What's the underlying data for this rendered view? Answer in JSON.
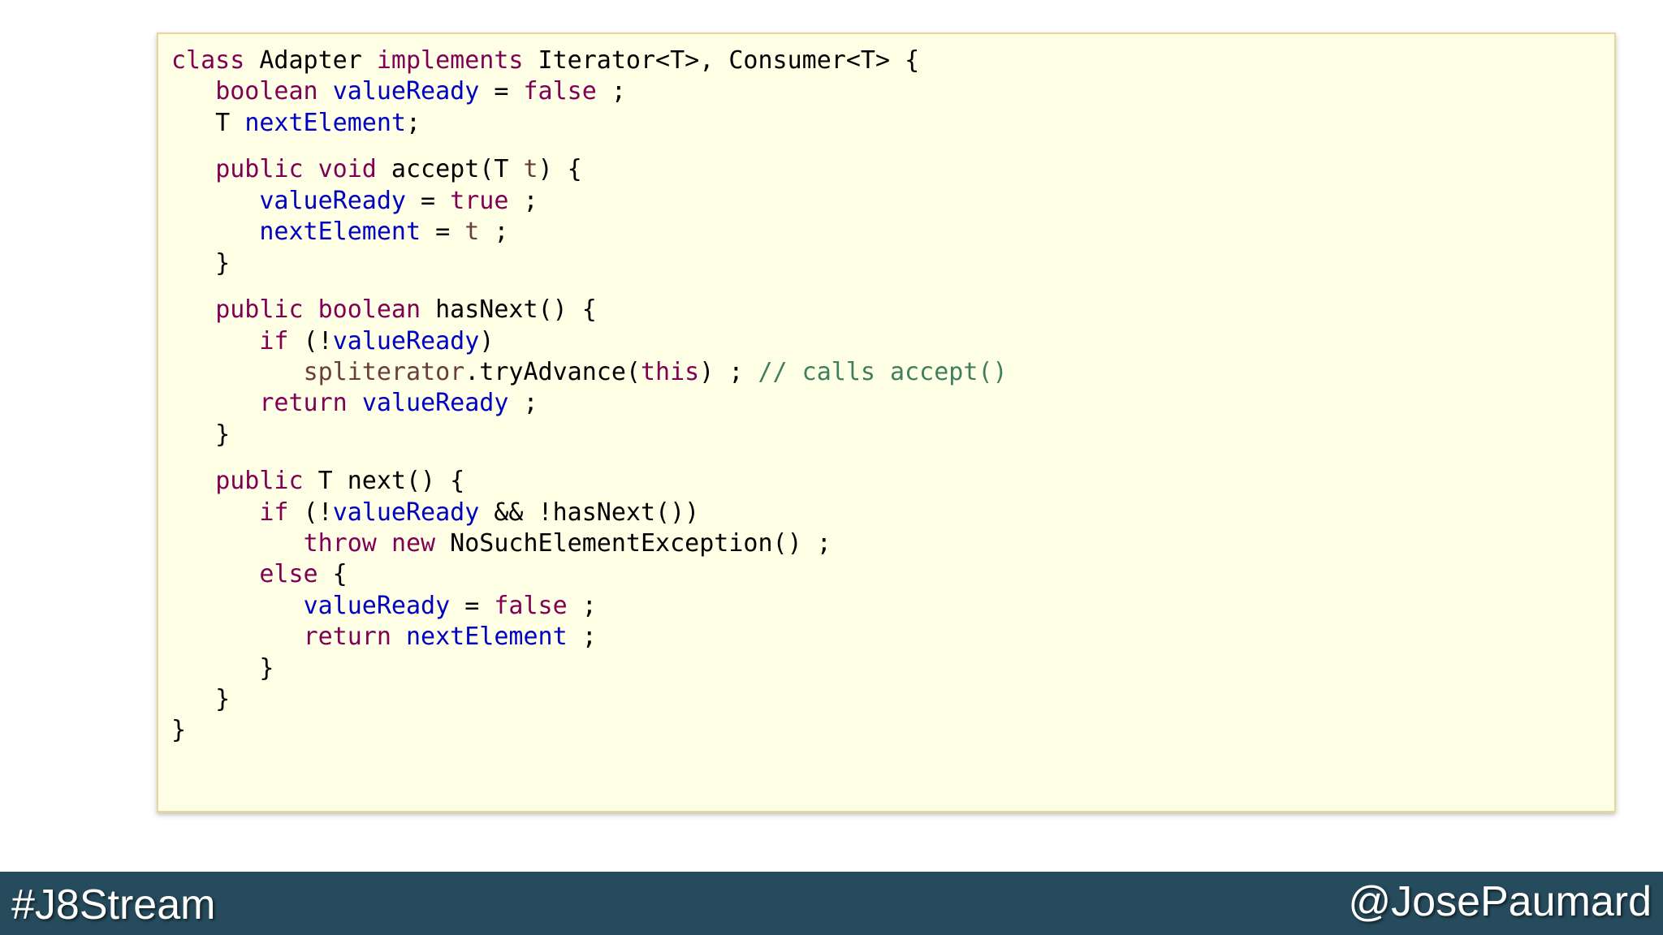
{
  "code": {
    "lines": [
      [
        {
          "t": "class",
          "c": "kw"
        },
        {
          "t": " Adapter "
        },
        {
          "t": "implements",
          "c": "kw"
        },
        {
          "t": " Iterator<T>, Consumer<T> {"
        }
      ],
      [
        {
          "t": "   "
        },
        {
          "t": "boolean",
          "c": "kw"
        },
        {
          "t": " "
        },
        {
          "t": "valueReady",
          "c": "fld"
        },
        {
          "t": " = "
        },
        {
          "t": "false",
          "c": "kw"
        },
        {
          "t": " ;"
        }
      ],
      [
        {
          "t": "   T "
        },
        {
          "t": "nextElement",
          "c": "fld"
        },
        {
          "t": ";"
        }
      ],
      "gap",
      [
        {
          "t": "   "
        },
        {
          "t": "public",
          "c": "kw"
        },
        {
          "t": " "
        },
        {
          "t": "void",
          "c": "kw"
        },
        {
          "t": " accept(T "
        },
        {
          "t": "t",
          "c": "prm"
        },
        {
          "t": ") {"
        }
      ],
      [
        {
          "t": "      "
        },
        {
          "t": "valueReady",
          "c": "fld"
        },
        {
          "t": " = "
        },
        {
          "t": "true",
          "c": "kw"
        },
        {
          "t": " ;"
        }
      ],
      [
        {
          "t": "      "
        },
        {
          "t": "nextElement",
          "c": "fld"
        },
        {
          "t": " = "
        },
        {
          "t": "t",
          "c": "prm"
        },
        {
          "t": " ;"
        }
      ],
      [
        {
          "t": "   }"
        }
      ],
      "gap",
      [
        {
          "t": "   "
        },
        {
          "t": "public",
          "c": "kw"
        },
        {
          "t": " "
        },
        {
          "t": "boolean",
          "c": "kw"
        },
        {
          "t": " hasNext() {"
        }
      ],
      [
        {
          "t": "      "
        },
        {
          "t": "if",
          "c": "kw"
        },
        {
          "t": " (!"
        },
        {
          "t": "valueReady",
          "c": "fld"
        },
        {
          "t": ")"
        }
      ],
      [
        {
          "t": "         "
        },
        {
          "t": "spliterator",
          "c": "prm"
        },
        {
          "t": ".tryAdvance("
        },
        {
          "t": "this",
          "c": "kw"
        },
        {
          "t": ") ; "
        },
        {
          "t": "// calls accept()",
          "c": "cmt"
        }
      ],
      [
        {
          "t": "      "
        },
        {
          "t": "return",
          "c": "kw"
        },
        {
          "t": " "
        },
        {
          "t": "valueReady",
          "c": "fld"
        },
        {
          "t": " ;"
        }
      ],
      [
        {
          "t": "   }"
        }
      ],
      "gap",
      [
        {
          "t": "   "
        },
        {
          "t": "public",
          "c": "kw"
        },
        {
          "t": " T next() {"
        }
      ],
      [
        {
          "t": "      "
        },
        {
          "t": "if",
          "c": "kw"
        },
        {
          "t": " (!"
        },
        {
          "t": "valueReady",
          "c": "fld"
        },
        {
          "t": " && !hasNext())"
        }
      ],
      [
        {
          "t": "         "
        },
        {
          "t": "throw",
          "c": "kw"
        },
        {
          "t": " "
        },
        {
          "t": "new",
          "c": "kw"
        },
        {
          "t": " NoSuchElementException() ;"
        }
      ],
      [
        {
          "t": "      "
        },
        {
          "t": "else",
          "c": "kw"
        },
        {
          "t": " {"
        }
      ],
      [
        {
          "t": "         "
        },
        {
          "t": "valueReady",
          "c": "fld"
        },
        {
          "t": " = "
        },
        {
          "t": "false",
          "c": "kw"
        },
        {
          "t": " ;"
        }
      ],
      [
        {
          "t": "         "
        },
        {
          "t": "return",
          "c": "kw"
        },
        {
          "t": " "
        },
        {
          "t": "nextElement",
          "c": "fld"
        },
        {
          "t": " ;"
        }
      ],
      [
        {
          "t": "      }"
        }
      ],
      [
        {
          "t": "   }"
        }
      ],
      [
        {
          "t": "}"
        }
      ]
    ]
  },
  "footer": {
    "hashtag": "#J8Stream",
    "handle": "@JosePaumard"
  },
  "colors": {
    "keyword": "#7f0055",
    "field": "#0000c0",
    "local": "#6a3e3e",
    "comment": "#3f7f5f",
    "code_background": "#ffffe6",
    "footer_background": "#264b5c"
  }
}
